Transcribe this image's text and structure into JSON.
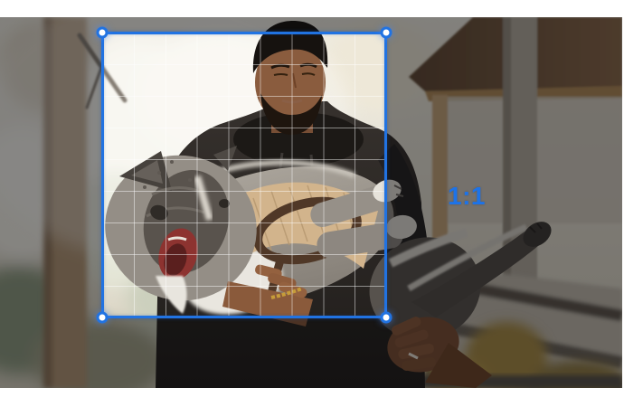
{
  "crop_tool": {
    "ratio_label": "1:1",
    "accent_color": "#2173e2",
    "label_color": "#1d73e8",
    "handle_color": "#ffffff",
    "grid": {
      "rows": 9,
      "cols": 9
    },
    "dim_opacity": 0.47,
    "handles": [
      {
        "id": "top-left"
      },
      {
        "id": "top-right"
      },
      {
        "id": "bottom-left"
      },
      {
        "id": "bottom-right"
      }
    ]
  },
  "photo": {
    "alt": "Man in a dark hoodie holding a gray French bulldog outdoors near a wooden pavilion"
  }
}
